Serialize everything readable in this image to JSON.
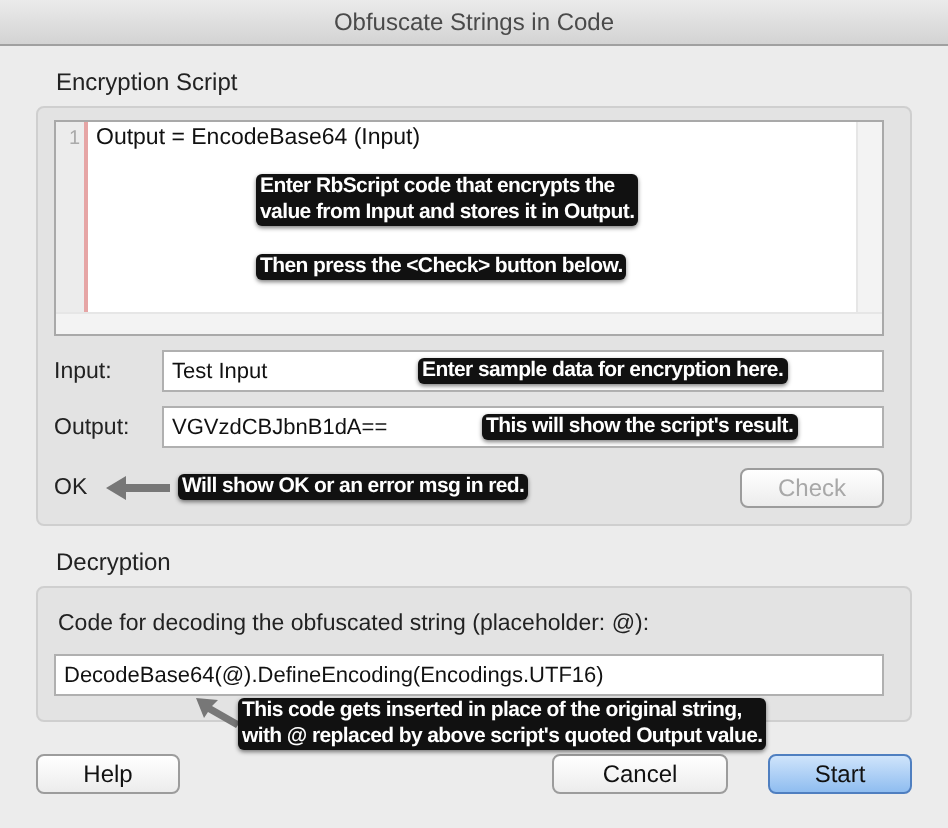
{
  "window": {
    "title": "Obfuscate Strings in Code"
  },
  "encryption": {
    "title": "Encryption Script",
    "editor": {
      "line_numbers": [
        "1"
      ],
      "code": "Output = EncodeBase64 (Input)",
      "annotation": [
        [
          "Enter RbScript code that encrypts the",
          "value from Input and stores it in Output."
        ],
        [
          "Then press the <Check> button below."
        ]
      ]
    },
    "fields": [
      {
        "label": "Input:",
        "value": "Test Input",
        "annotation": "Enter sample data for encryption here."
      },
      {
        "label": "Output:",
        "value": "VGVzdCBJbnB1dA==",
        "annotation": "This will show the script's result."
      }
    ],
    "status": {
      "text": "OK",
      "annotation": "Will show OK or an error msg in red."
    },
    "check_button": {
      "label": "Check",
      "disabled": true
    }
  },
  "decryption": {
    "title": "Decryption",
    "description": "Code for decoding the obfuscated string (placeholder: @):",
    "code": "DecodeBase64(@).DefineEncoding(Encodings.UTF16)",
    "annotation": [
      "This code gets inserted in place of the original string,",
      "with @ replaced by above script's quoted Output value."
    ]
  },
  "buttons": [
    {
      "label": "Help",
      "default": false
    },
    {
      "label": "Cancel",
      "default": false
    },
    {
      "label": "Start",
      "default": true
    }
  ]
}
